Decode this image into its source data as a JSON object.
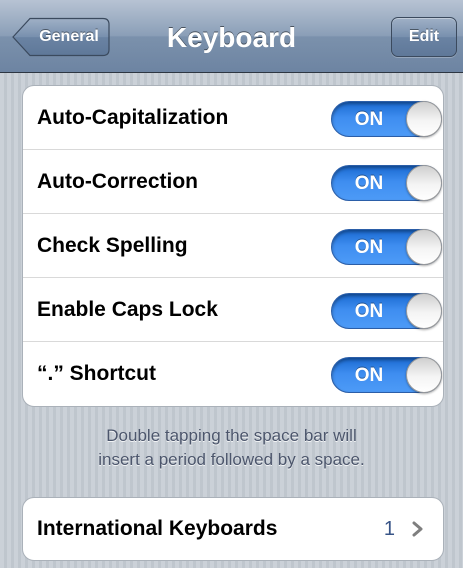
{
  "navbar": {
    "back_label": "General",
    "title": "Keyboard",
    "edit_label": "Edit"
  },
  "settings": {
    "toggles": [
      {
        "label": "Auto-Capitalization",
        "state": "ON"
      },
      {
        "label": "Auto-Correction",
        "state": "ON"
      },
      {
        "label": "Check Spelling",
        "state": "ON"
      },
      {
        "label": "Enable Caps Lock",
        "state": "ON"
      },
      {
        "label": "“.” Shortcut",
        "state": "ON"
      }
    ],
    "footer_lines": [
      "Double tapping the space bar will",
      "insert a period followed by a space."
    ],
    "international": {
      "label": "International Keyboards",
      "value": "1"
    }
  },
  "colors": {
    "switch_on": "#3e8df0",
    "navbar": "#7b91ac",
    "value_text": "#385487"
  },
  "icons": {
    "back": "chevron-left-icon",
    "disclosure": "chevron-right-icon"
  }
}
